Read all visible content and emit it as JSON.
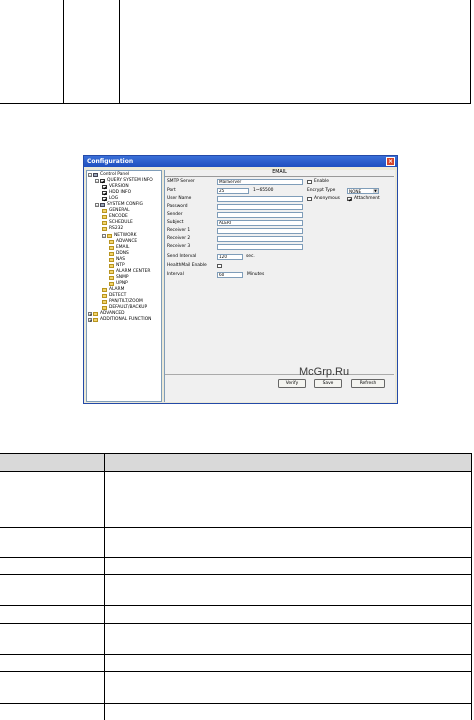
{
  "window": {
    "title": "Configuration"
  },
  "tree": [
    {
      "label": "Control Panel",
      "icon": "computer-icon",
      "level": 0,
      "expander": "-"
    },
    {
      "label": "QUERY SYSTEM INFO",
      "icon": "check-icon",
      "level": 1,
      "expander": "-"
    },
    {
      "label": "VERSION",
      "icon": "check-icon",
      "level": 2
    },
    {
      "label": "HDD INFO",
      "icon": "check-icon",
      "level": 2
    },
    {
      "label": "LOG",
      "icon": "check-icon",
      "level": 2
    },
    {
      "label": "SYSTEM CONFIG",
      "icon": "gear-icon",
      "level": 1,
      "expander": "-"
    },
    {
      "label": "GENERAL",
      "icon": "folder-icon",
      "level": 2
    },
    {
      "label": "ENCODE",
      "icon": "folder-icon",
      "level": 2
    },
    {
      "label": "SCHEDULE",
      "icon": "folder-icon",
      "level": 2
    },
    {
      "label": "RS232",
      "icon": "folder-icon",
      "level": 2
    },
    {
      "label": "NETWORK",
      "icon": "folder-icon",
      "level": 2,
      "expander": "-"
    },
    {
      "label": "ADVANCE",
      "icon": "folder-icon",
      "level": 3
    },
    {
      "label": "EMAIL",
      "icon": "folder-icon",
      "level": 3
    },
    {
      "label": "DDNS",
      "icon": "folder-icon",
      "level": 3
    },
    {
      "label": "NAS",
      "icon": "folder-icon",
      "level": 3
    },
    {
      "label": "NTP",
      "icon": "folder-icon",
      "level": 3
    },
    {
      "label": "ALARM CENTER",
      "icon": "folder-icon",
      "level": 3
    },
    {
      "label": "SNMP",
      "icon": "folder-icon",
      "level": 3
    },
    {
      "label": "UPNP",
      "icon": "folder-icon",
      "level": 3
    },
    {
      "label": "ALARM",
      "icon": "folder-icon",
      "level": 2
    },
    {
      "label": "DETECT",
      "icon": "folder-icon",
      "level": 2
    },
    {
      "label": "PAN/TILT/ZOOM",
      "icon": "folder-icon",
      "level": 2
    },
    {
      "label": "DEFAULT/BACKUP",
      "icon": "folder-icon",
      "level": 2
    },
    {
      "label": "ADVANCED",
      "icon": "tools-icon",
      "level": 0,
      "expander": "+"
    },
    {
      "label": "ADDITIONAL FUNCTION",
      "icon": "folder-icon",
      "level": 0,
      "expander": "+"
    }
  ],
  "email": {
    "header": "EMAIL",
    "smtp_server_label": "SMTP Server",
    "smtp_server_value": "MailServer",
    "enable_label": "Enable",
    "port_label": "Port",
    "port_value": "25",
    "port_range": "1~65500",
    "encrypt_label": "Encrypt Type",
    "encrypt_value": "NONE",
    "username_label": "User Name",
    "anonymous_label": "Anonymous",
    "attachment_label": "Attachment",
    "password_label": "Password",
    "sender_label": "Sender",
    "subject_label": "Subject",
    "subject_value": "ALERT",
    "receiver1_label": "Receiver 1",
    "receiver2_label": "Receiver 2",
    "receiver3_label": "Receiver 3",
    "send_interval_label": "Send Interval",
    "send_interval_value": "120",
    "send_interval_unit": "sec.",
    "health_mail_label": "HealthMail Enable",
    "interval_label": "Interval",
    "interval_value": "60",
    "interval_unit": "Minutes"
  },
  "buttons": {
    "verify": "Verify",
    "save": "Save",
    "refresh": "Refresh"
  },
  "watermark": "McGrp.Ru"
}
